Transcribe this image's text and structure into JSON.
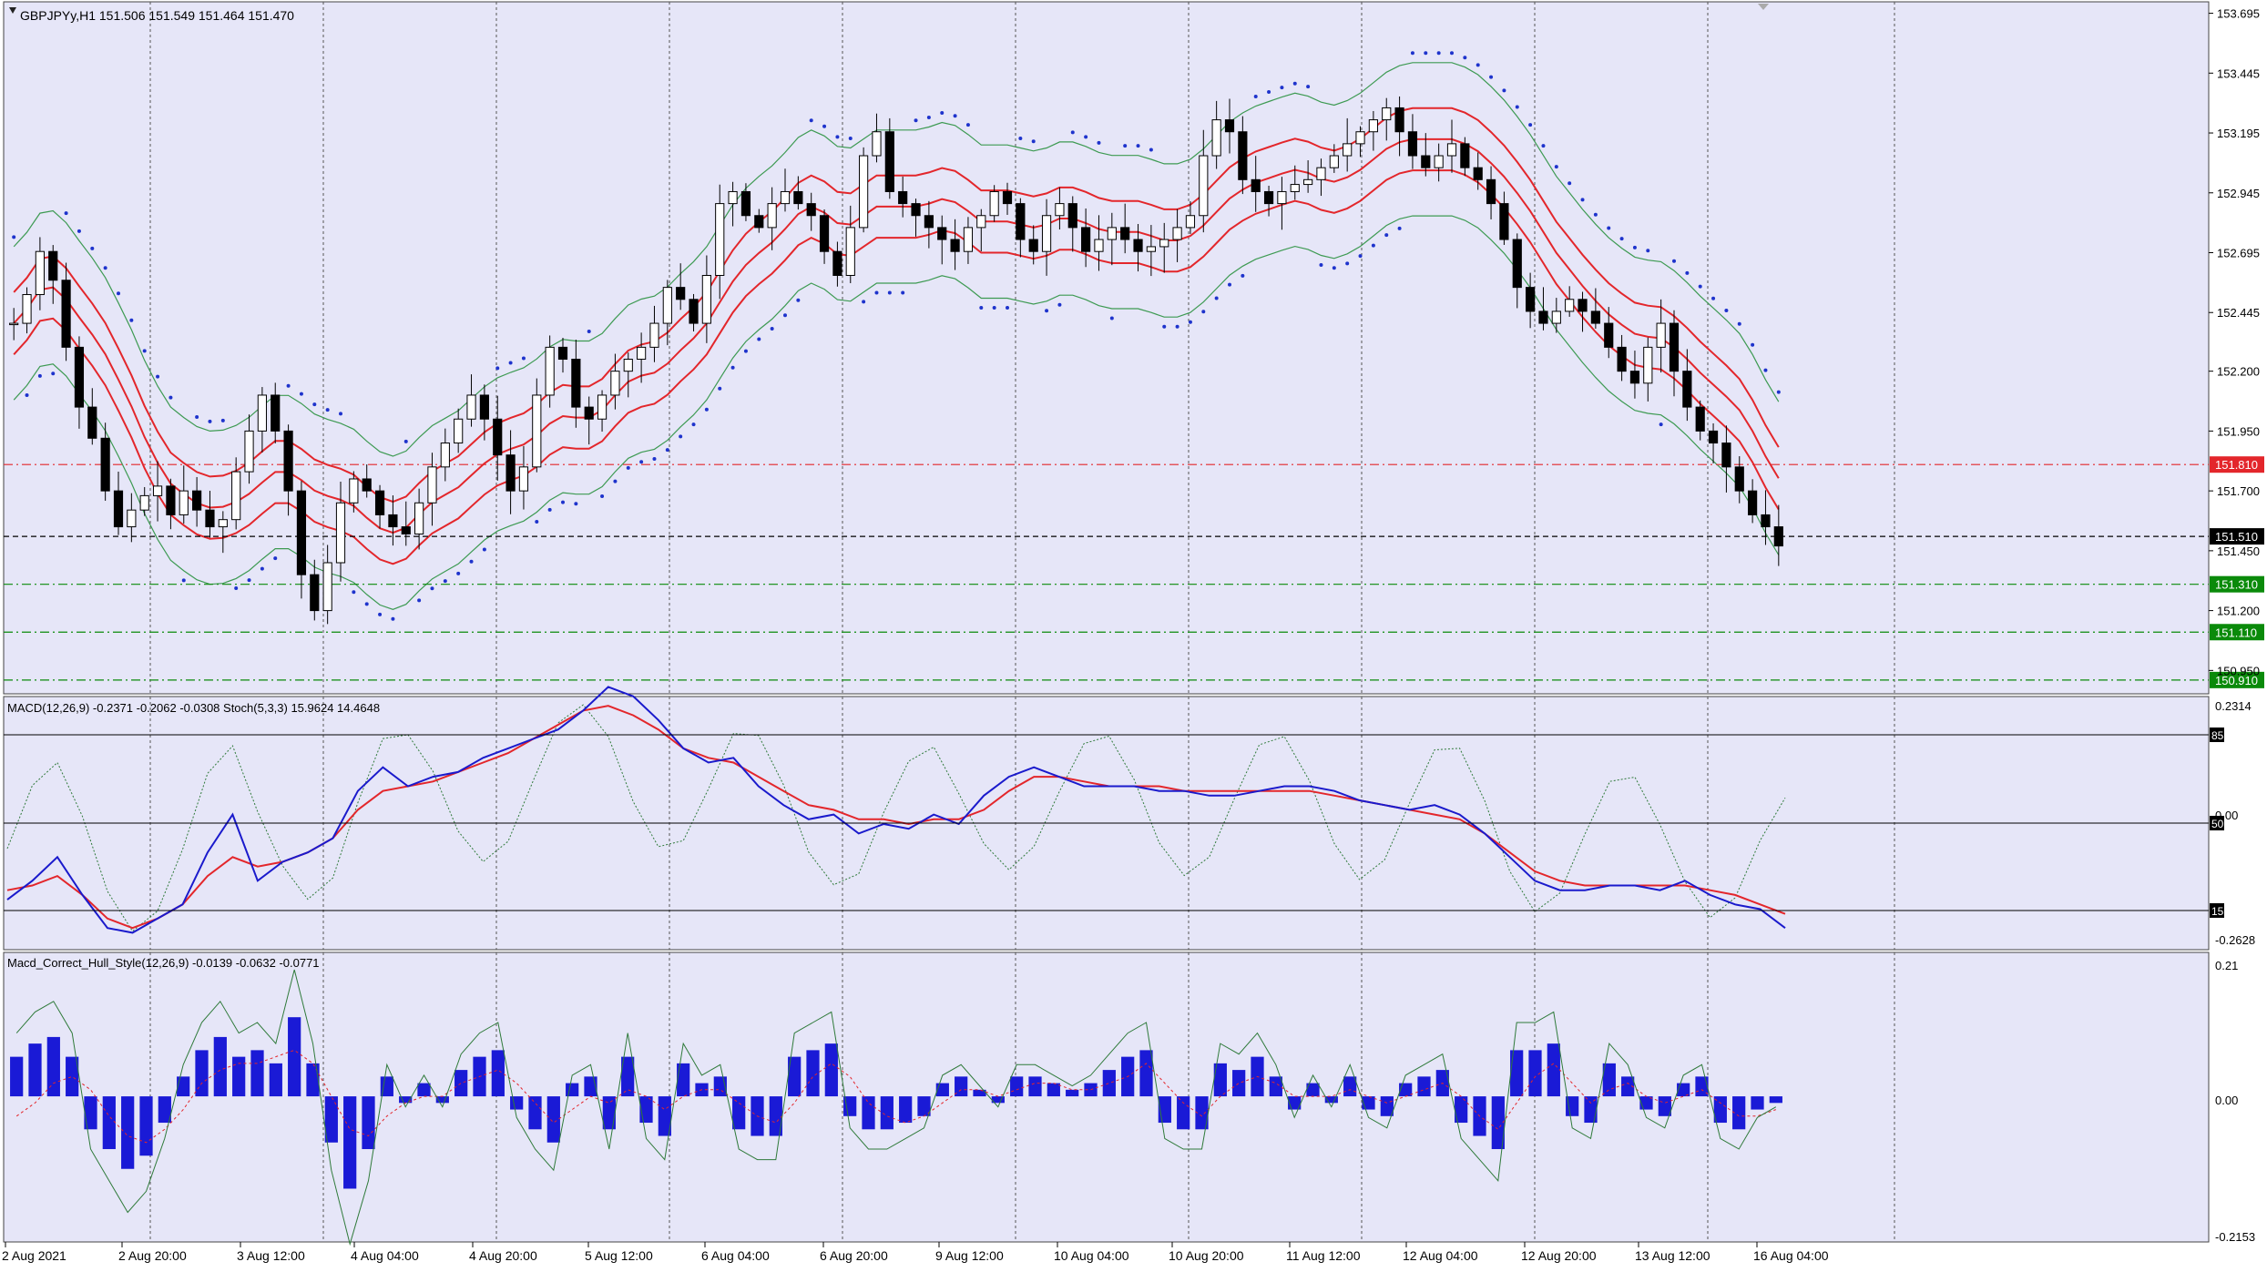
{
  "window": {
    "symbol_header": "GBPJPYy,H1  151.506 151.549 151.464 151.470",
    "bg_color": "#e6e6f8",
    "axis_bg": "#ffffff"
  },
  "chart_data": [
    {
      "type": "candlestick",
      "panel": "price",
      "title": "GBPJPYy,H1",
      "ohlc": {
        "open": 151.506,
        "high": 151.549,
        "low": 151.464,
        "close": 151.47
      },
      "ylim": [
        150.86,
        153.72
      ],
      "y_ticks": [
        "153.695",
        "153.445",
        "153.195",
        "152.945",
        "152.695",
        "152.445",
        "152.200",
        "151.950",
        "151.700",
        "151.450",
        "151.200",
        "150.950"
      ],
      "price_path": [
        152.4,
        152.52,
        152.7,
        152.58,
        152.3,
        152.05,
        151.92,
        151.7,
        151.55,
        151.62,
        151.68,
        151.72,
        151.6,
        151.7,
        151.62,
        151.55,
        151.58,
        151.78,
        151.95,
        152.1,
        151.95,
        151.7,
        151.35,
        151.2,
        151.4,
        151.65,
        151.75,
        151.7,
        151.6,
        151.55,
        151.52,
        151.65,
        151.8,
        151.9,
        152.0,
        152.1,
        152.0,
        151.85,
        151.7,
        151.8,
        152.1,
        152.3,
        152.25,
        152.05,
        152.0,
        152.1,
        152.2,
        152.25,
        152.3,
        152.4,
        152.55,
        152.5,
        152.4,
        152.6,
        152.9,
        152.95,
        152.85,
        152.8,
        152.9,
        152.95,
        152.9,
        152.85,
        152.7,
        152.6,
        152.8,
        153.1,
        153.2,
        152.95,
        152.9,
        152.85,
        152.8,
        152.75,
        152.7,
        152.8,
        152.85,
        152.95,
        152.9,
        152.75,
        152.7,
        152.85,
        152.9,
        152.8,
        152.7,
        152.75,
        152.8,
        152.75,
        152.7,
        152.72,
        152.75,
        152.8,
        152.85,
        153.1,
        153.25,
        153.2,
        153.0,
        152.95,
        152.9,
        152.95,
        152.98,
        153.0,
        153.05,
        153.1,
        153.15,
        153.2,
        153.25,
        153.3,
        153.2,
        153.1,
        153.05,
        153.1,
        153.15,
        153.05,
        153.0,
        152.9,
        152.75,
        152.55,
        152.45,
        152.4,
        152.45,
        152.5,
        152.45,
        152.4,
        152.3,
        152.2,
        152.15,
        152.3,
        152.4,
        152.2,
        152.05,
        151.95,
        151.9,
        151.8,
        151.7,
        151.6,
        151.55,
        151.47
      ],
      "levels": [
        {
          "label": "151.810",
          "value": 151.81,
          "color": "#e3262b",
          "style": "dash-dot"
        },
        {
          "label": "151.510",
          "value": 151.51,
          "color": "#000000",
          "style": "dash"
        },
        {
          "label": "151.310",
          "value": 151.31,
          "color": "#0a8a0a",
          "style": "dash-dot"
        },
        {
          "label": "151.110",
          "value": 151.11,
          "color": "#0a8a0a",
          "style": "dash-dot"
        },
        {
          "label": "150.910",
          "value": 150.91,
          "color": "#0a8a0a",
          "style": "dash-dot"
        }
      ]
    },
    {
      "type": "line",
      "panel": "macd",
      "title": "MACD(12,26,9) -0.2371 -0.2062 -0.0308  Stoch(5,3,3) 15.9624 14.4648",
      "y_ticks": [
        "0.2314",
        "0.00",
        "-0.2628"
      ],
      "stoch_levels": [
        "85",
        "50",
        "15"
      ],
      "macd": [
        -0.18,
        -0.14,
        -0.09,
        -0.17,
        -0.24,
        -0.25,
        -0.22,
        -0.19,
        -0.08,
        0.0,
        -0.14,
        -0.1,
        -0.08,
        -0.05,
        0.05,
        0.1,
        0.06,
        0.08,
        0.09,
        0.12,
        0.14,
        0.16,
        0.18,
        0.22,
        0.27,
        0.25,
        0.2,
        0.14,
        0.11,
        0.12,
        0.06,
        0.02,
        -0.01,
        0.0,
        -0.04,
        -0.02,
        -0.03,
        0.0,
        -0.02,
        0.04,
        0.08,
        0.1,
        0.08,
        0.06,
        0.06,
        0.06,
        0.05,
        0.05,
        0.04,
        0.04,
        0.05,
        0.06,
        0.06,
        0.05,
        0.03,
        0.02,
        0.01,
        0.02,
        0.0,
        -0.04,
        -0.09,
        -0.14,
        -0.16,
        -0.16,
        -0.15,
        -0.15,
        -0.16,
        -0.14,
        -0.17,
        -0.19,
        -0.2,
        -0.24
      ],
      "signal": [
        -0.16,
        -0.15,
        -0.13,
        -0.17,
        -0.22,
        -0.24,
        -0.22,
        -0.19,
        -0.13,
        -0.09,
        -0.11,
        -0.1,
        -0.08,
        -0.05,
        0.01,
        0.05,
        0.06,
        0.07,
        0.09,
        0.11,
        0.13,
        0.16,
        0.19,
        0.22,
        0.23,
        0.21,
        0.18,
        0.14,
        0.12,
        0.11,
        0.08,
        0.05,
        0.02,
        0.01,
        -0.01,
        -0.01,
        -0.02,
        -0.01,
        -0.01,
        0.01,
        0.05,
        0.08,
        0.08,
        0.07,
        0.06,
        0.06,
        0.06,
        0.05,
        0.05,
        0.05,
        0.05,
        0.05,
        0.05,
        0.04,
        0.03,
        0.02,
        0.01,
        0.0,
        -0.01,
        -0.04,
        -0.08,
        -0.12,
        -0.14,
        -0.15,
        -0.15,
        -0.15,
        -0.15,
        -0.15,
        -0.16,
        -0.17,
        -0.19,
        -0.21
      ]
    },
    {
      "type": "bar",
      "panel": "hull_macd",
      "title": "Macd_Correct_Hull_Style(12,26,9) -0.0139 -0.0632 -0.0771",
      "y_ticks": [
        "0.21",
        "0.00",
        "-0.2153"
      ],
      "ylim": [
        -0.2153,
        0.21
      ],
      "values": [
        0.06,
        0.08,
        0.09,
        0.06,
        -0.05,
        -0.08,
        -0.11,
        -0.09,
        -0.04,
        0.03,
        0.07,
        0.09,
        0.06,
        0.07,
        0.05,
        0.12,
        0.05,
        -0.07,
        -0.14,
        -0.08,
        0.03,
        -0.01,
        0.02,
        -0.01,
        0.04,
        0.06,
        0.07,
        -0.02,
        -0.05,
        -0.07,
        0.02,
        0.03,
        -0.05,
        0.06,
        -0.04,
        -0.06,
        0.05,
        0.02,
        0.03,
        -0.05,
        -0.06,
        -0.06,
        0.06,
        0.07,
        0.08,
        -0.03,
        -0.05,
        -0.05,
        -0.04,
        -0.03,
        0.02,
        0.03,
        0.01,
        -0.01,
        0.03,
        0.03,
        0.02,
        0.01,
        0.02,
        0.04,
        0.06,
        0.07,
        -0.04,
        -0.05,
        -0.05,
        0.05,
        0.04,
        0.06,
        0.03,
        -0.02,
        0.02,
        -0.01,
        0.03,
        -0.02,
        -0.03,
        0.02,
        0.03,
        0.04,
        -0.04,
        -0.06,
        -0.08,
        0.07,
        0.07,
        0.08,
        -0.03,
        -0.04,
        0.05,
        0.03,
        -0.02,
        -0.03,
        0.02,
        0.03,
        -0.04,
        -0.05,
        -0.02,
        -0.01
      ],
      "signal": [
        -0.03,
        -0.01,
        0.02,
        0.03,
        0.01,
        -0.03,
        -0.06,
        -0.07,
        -0.05,
        -0.02,
        0.02,
        0.04,
        0.05,
        0.05,
        0.06,
        0.07,
        0.05,
        0.0,
        -0.05,
        -0.06,
        -0.03,
        -0.01,
        0.0,
        0.0,
        0.02,
        0.03,
        0.04,
        0.02,
        -0.01,
        -0.04,
        -0.02,
        0.0,
        -0.01,
        0.01,
        0.0,
        -0.02,
        0.0,
        0.01,
        0.01,
        -0.01,
        -0.03,
        -0.04,
        -0.01,
        0.03,
        0.05,
        0.03,
        -0.01,
        -0.03,
        -0.04,
        -0.03,
        -0.01,
        0.01,
        0.01,
        0.0,
        0.01,
        0.02,
        0.02,
        0.01,
        0.01,
        0.02,
        0.03,
        0.05,
        0.02,
        -0.01,
        -0.03,
        0.0,
        0.02,
        0.03,
        0.02,
        0.0,
        0.0,
        0.0,
        0.01,
        0.0,
        -0.01,
        0.0,
        0.01,
        0.02,
        0.0,
        -0.03,
        -0.05,
        -0.01,
        0.03,
        0.05,
        0.02,
        -0.01,
        0.01,
        0.02,
        0.0,
        -0.01,
        0.0,
        0.01,
        -0.01,
        -0.03,
        -0.03,
        -0.02
      ]
    }
  ],
  "x_axis_labels": [
    "2 Aug 2021",
    "2 Aug 20:00",
    "3 Aug 12:00",
    "4 Aug 04:00",
    "4 Aug 20:00",
    "5 Aug 12:00",
    "6 Aug 04:00",
    "6 Aug 20:00",
    "9 Aug 12:00",
    "10 Aug 04:00",
    "10 Aug 20:00",
    "11 Aug 12:00",
    "12 Aug 04:00",
    "12 Aug 20:00",
    "13 Aug 12:00",
    "16 Aug 04:00"
  ],
  "colors": {
    "panel_bg": "#e6e6f8",
    "bull": "#ffffff",
    "bear": "#000000",
    "bands_red": "#e3262b",
    "bands_green": "#3d9a52",
    "psar": "#1e33cc",
    "macd_line": "#1a1acc",
    "signal_line": "#e3262b",
    "stoch": "#2f7a3a",
    "hist": "#1a1ad6"
  }
}
